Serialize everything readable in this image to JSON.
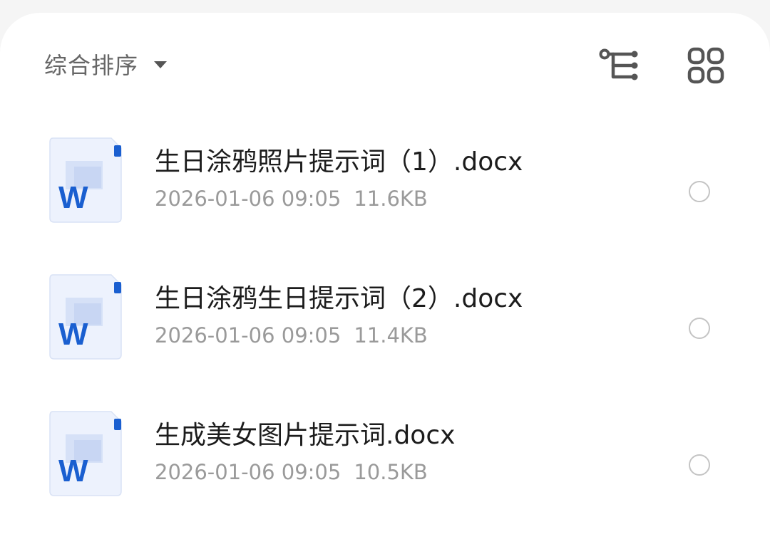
{
  "toolbar": {
    "sort_label": "综合排序",
    "sort_icon": "caret-down-icon",
    "tree_icon": "tree-view-icon",
    "grid_icon": "grid-view-icon"
  },
  "colors": {
    "word_blue": "#1a5fd0",
    "doc_bg": "#edf2fd"
  },
  "files": [
    {
      "name": "生日涂鸦照片提示词（1）.docx",
      "date": "2026-01-06 09:05",
      "size": "11.6KB",
      "icon": "word-doc-icon",
      "icon_letter": "W"
    },
    {
      "name": "生日涂鸦生日提示词（2）.docx",
      "date": "2026-01-06 09:05",
      "size": "11.4KB",
      "icon": "word-doc-icon",
      "icon_letter": "W"
    },
    {
      "name": "生成美女图片提示词.docx",
      "date": "2026-01-06 09:05",
      "size": "10.5KB",
      "icon": "word-doc-icon",
      "icon_letter": "W"
    }
  ]
}
